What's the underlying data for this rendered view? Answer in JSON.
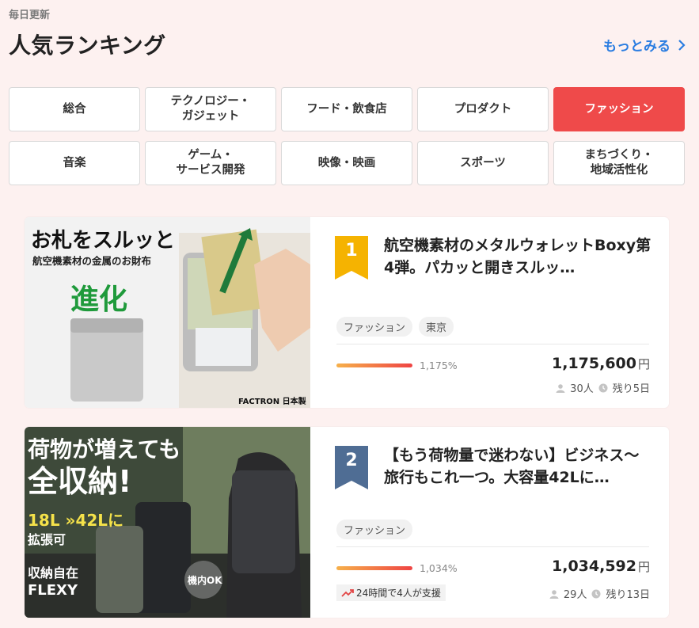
{
  "header": {
    "eyebrow": "毎日更新",
    "title": "人気ランキング",
    "more_label": "もっとみる"
  },
  "categories": [
    {
      "label": "総合",
      "active": false
    },
    {
      "label": "テクノロジー・\nガジェット",
      "active": false
    },
    {
      "label": "フード・飲食店",
      "active": false
    },
    {
      "label": "プロダクト",
      "active": false
    },
    {
      "label": "ファッション",
      "active": true
    },
    {
      "label": "音楽",
      "active": false
    },
    {
      "label": "ゲーム・\nサービス開発",
      "active": false
    },
    {
      "label": "映像・映画",
      "active": false
    },
    {
      "label": "スポーツ",
      "active": false
    },
    {
      "label": "まちづくり・\n地域活性化",
      "active": false
    }
  ],
  "projects": [
    {
      "rank": "1",
      "rank_color": "#f5b301",
      "title": "航空機素材のメタルウォレットBoxy第4弾。パカッと開きスルッ…",
      "tags": [
        "ファッション",
        "東京"
      ],
      "progress_pct": "1,175%",
      "amount": "1,175,600",
      "currency": "円",
      "supporters": "30人",
      "remaining": "残り5日",
      "image": {
        "headline": "お札をスルッと",
        "sub": "航空機素材の金属のお財布",
        "big": "進化",
        "brand": "FACTRON 日本製"
      }
    },
    {
      "rank": "2",
      "rank_color": "#4f6d94",
      "title": "【もう荷物量で迷わない】ビジネス～旅行もこれ一つ。大容量42Lに…",
      "tags": [
        "ファッション"
      ],
      "progress_pct": "1,034%",
      "amount": "1,034,592",
      "currency": "円",
      "supporters": "29人",
      "remaining": "残り13日",
      "support_note": "24時間で4人が支援",
      "image": {
        "line1": "荷物が増えても",
        "line2": "全収納!",
        "expand": "18L »42Lに",
        "expand2": "拡張可",
        "feature": "収納自在",
        "brand": "FLEXY",
        "badge": "機内OK"
      }
    }
  ]
}
